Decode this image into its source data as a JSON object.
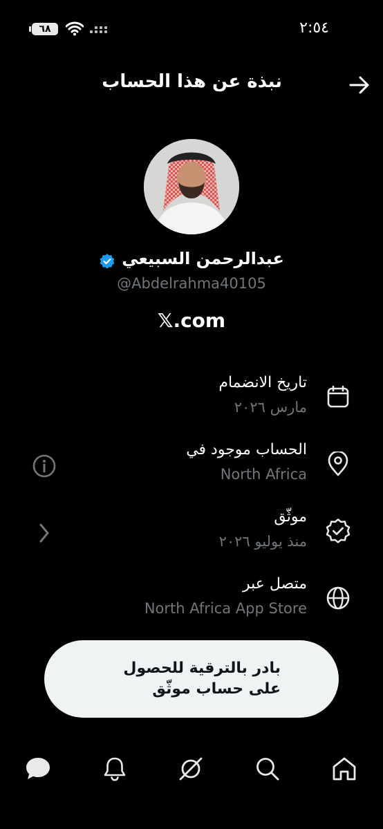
{
  "status_bar": {
    "time": "٢:٥٤",
    "battery": "٦٨"
  },
  "header": {
    "title": "نبذة عن هذا الحساب"
  },
  "profile": {
    "name": "عبدالرحمن السبيعي",
    "handle": "@Abdelrahma40105",
    "site": "𝕏.com"
  },
  "details": [
    {
      "label": "تاريخ الانضمام",
      "value": "مارس ٢٠٢٦",
      "icon": "calendar-icon"
    },
    {
      "label": "الحساب موجود في",
      "value": "North Africa",
      "icon": "location-pin-icon"
    },
    {
      "label": "موثّق",
      "value": "منذ يوليو ٢٠٢٦",
      "icon": "verified-badge-icon"
    },
    {
      "label": "متصل عبر",
      "value": "North Africa App Store",
      "icon": "globe-icon"
    }
  ],
  "cta": {
    "label": "بادر بالترقية للحصول على حساب موثّق"
  },
  "nav": [
    "chat-icon",
    "bell-icon",
    "grok-icon",
    "search-icon",
    "home-icon"
  ],
  "colors": {
    "background": "#000000",
    "muted": "#71767b",
    "verified": "#1d9bf0",
    "cta_bg": "#eff3f4"
  }
}
